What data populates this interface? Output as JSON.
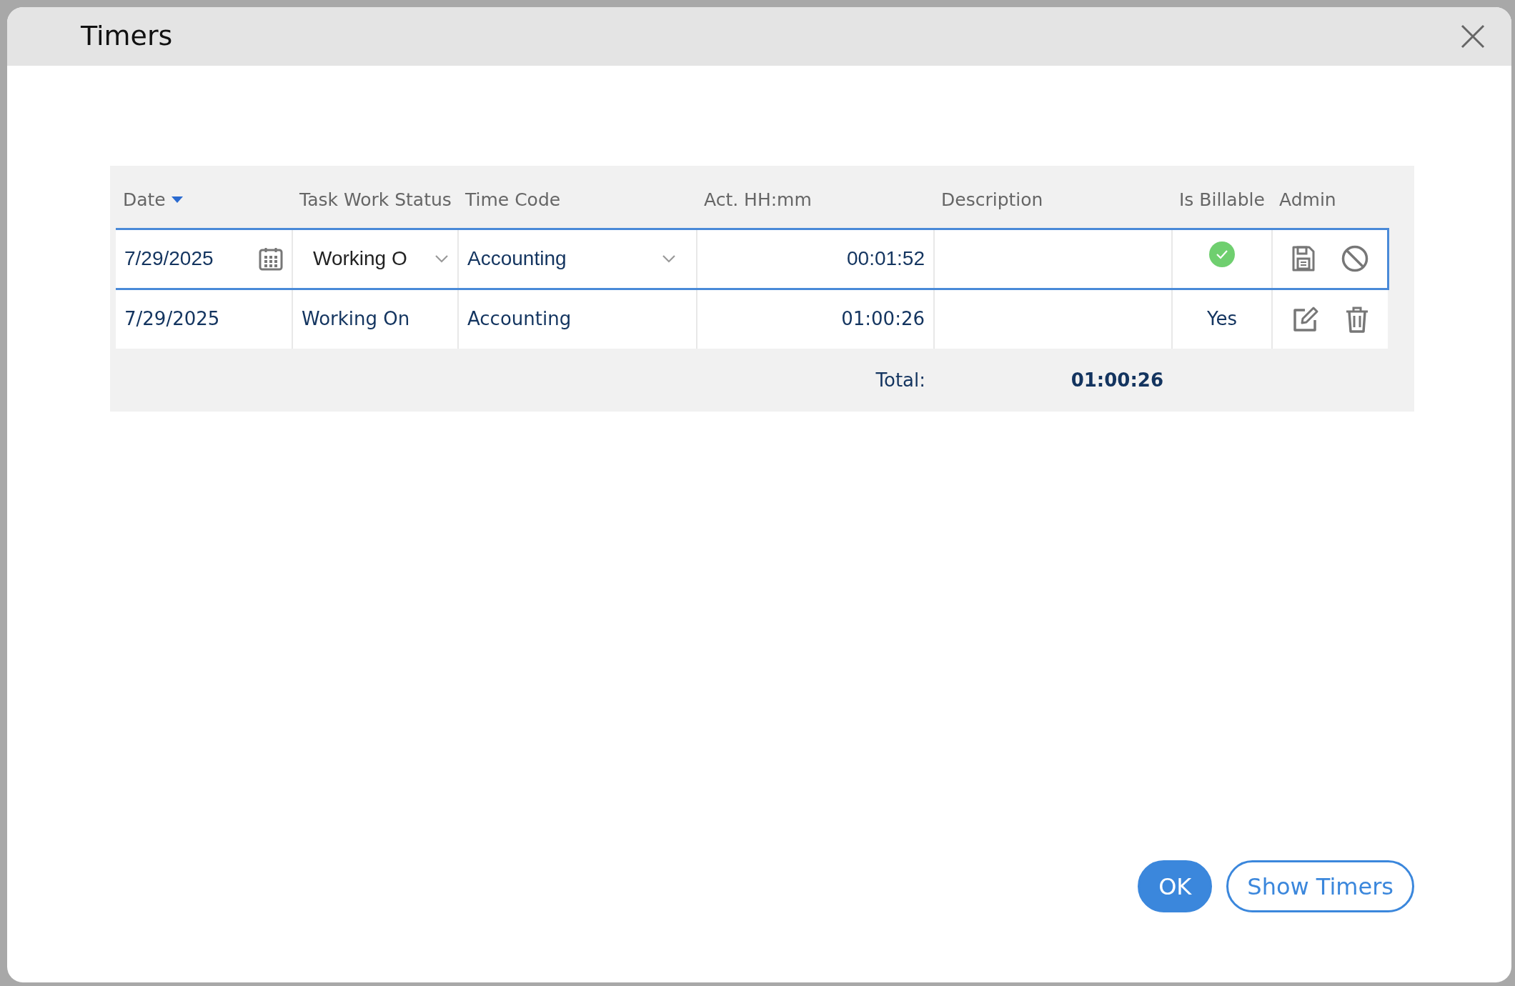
{
  "dialog": {
    "title": "Timers"
  },
  "table": {
    "columns": [
      {
        "label": "Date",
        "sorted": true
      },
      {
        "label": "Task Work Status",
        "sorted": false
      },
      {
        "label": "Time Code",
        "sorted": false
      },
      {
        "label": "Act. HH:mm",
        "sorted": false
      },
      {
        "label": "Description",
        "sorted": false
      },
      {
        "label": "Is Billable",
        "sorted": false
      },
      {
        "label": "Admin",
        "sorted": false
      }
    ],
    "edit_row": {
      "date": "7/29/2025",
      "status": "Working O",
      "time_code": "Accounting",
      "actual": "00:01:52",
      "billable": true
    },
    "rows": [
      {
        "date": "7/29/2025",
        "status": "Working On",
        "time_code": "Accounting",
        "actual": "01:00:26",
        "billable": "Yes"
      }
    ],
    "total": {
      "label": "Total:",
      "value": "01:00:26"
    }
  },
  "buttons": [
    {
      "label": "OK",
      "kind": "primary"
    },
    {
      "label": "Show Timers",
      "kind": "outline"
    }
  ]
}
